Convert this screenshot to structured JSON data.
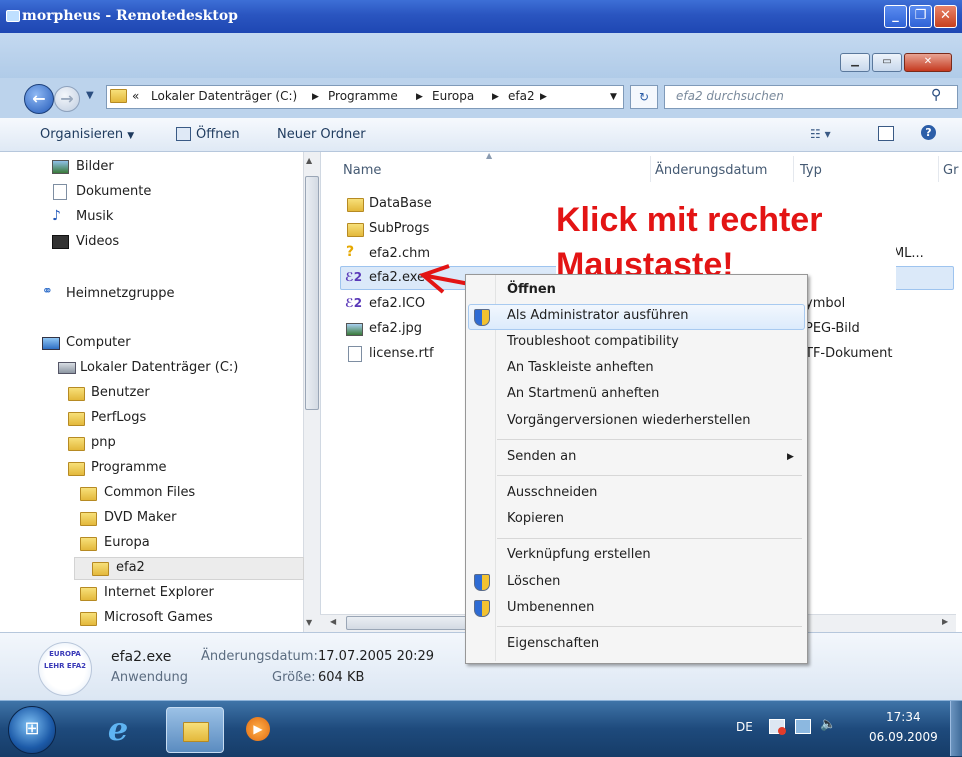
{
  "rdp": {
    "title": "morpheus - Remotedesktop"
  },
  "address": {
    "prefix": "«",
    "crumbs": [
      "Lokaler Datenträger (C:)",
      "Programme",
      "Europa",
      "efa2"
    ],
    "search_placeholder": "efa2 durchsuchen"
  },
  "toolbar": {
    "organize": "Organisieren",
    "open": "Öffnen",
    "new_folder": "Neuer Ordner"
  },
  "nav": {
    "items": [
      "Bilder",
      "Dokumente",
      "Musik",
      "Videos",
      "Heimnetzgruppe",
      "Computer",
      "Lokaler Datenträger (C:)",
      "Benutzer",
      "PerfLogs",
      "pnp",
      "Programme",
      "Common Files",
      "DVD Maker",
      "Europa",
      "efa2",
      "Internet Explorer",
      "Microsoft Games"
    ]
  },
  "columns": {
    "name": "Name",
    "date": "Änderungsdatum",
    "type": "Typ",
    "size": "Gr"
  },
  "files": [
    {
      "name": "DataBase",
      "type": ""
    },
    {
      "name": "SubProgs",
      "type": ""
    },
    {
      "name": "efa2.chm",
      "type": "TML..."
    },
    {
      "name": "efa2.exe",
      "type": ""
    },
    {
      "name": "efa2.ICO",
      "type": "ymbol"
    },
    {
      "name": "efa2.jpg",
      "type": "PEG-Bild"
    },
    {
      "name": "license.rtf",
      "type": "TF-Dokument"
    }
  ],
  "annotation": {
    "line1": "Klick mit rechter",
    "line2": "Maustaste!"
  },
  "context_menu": {
    "items": [
      "Öffnen",
      "Als Administrator ausführen",
      "Troubleshoot compatibility",
      "An Taskleiste anheften",
      "An Startmenü anheften",
      "Vorgängerversionen wiederherstellen",
      "Senden an",
      "Ausschneiden",
      "Kopieren",
      "Verknüpfung erstellen",
      "Löschen",
      "Umbenennen",
      "Eigenschaften"
    ]
  },
  "details": {
    "filename": "efa2.exe",
    "filetype": "Anwendung",
    "date_label": "Änderungsdatum:",
    "date_value": "17.07.2005 20:29",
    "size_label": "Größe:",
    "size_value": "604 KB",
    "logo_text": "EUROPA LEHR EFA2"
  },
  "taskbar": {
    "lang": "DE",
    "time": "17:34",
    "date": "06.09.2009"
  }
}
